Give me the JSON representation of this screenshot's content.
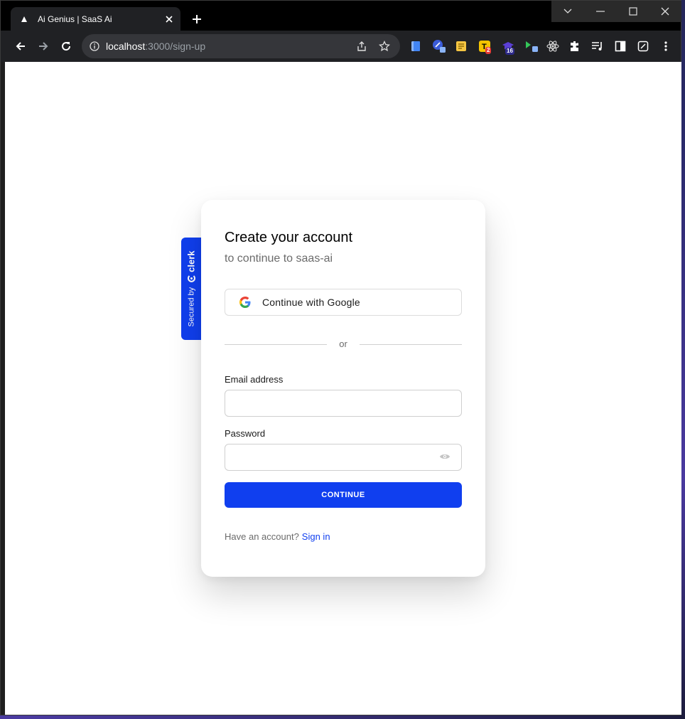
{
  "browser": {
    "tab_title": "Ai Genius | SaaS Ai",
    "url_host": "localhost",
    "url_path": ":3000/sign-up",
    "extensions": [
      {
        "name": "docs-ext-icon"
      },
      {
        "name": "translate-ext-icon"
      },
      {
        "name": "notes-ext-icon"
      },
      {
        "name": "tampermonkey-ext-icon",
        "badge": "2"
      },
      {
        "name": "grad-cap-ext-icon",
        "badge": "16"
      },
      {
        "name": "video-ext-icon"
      },
      {
        "name": "react-devtools-icon"
      },
      {
        "name": "puzzle-extensions-icon"
      },
      {
        "name": "media-controls-icon"
      },
      {
        "name": "side-panel-icon"
      },
      {
        "name": "notion-ext-icon"
      }
    ]
  },
  "secured_badge": {
    "prefix": "Secured by",
    "brand": "clerk"
  },
  "signup": {
    "title": "Create your account",
    "subtitle": "to continue to saas-ai",
    "google_button": "Continue with Google",
    "divider": "or",
    "email_label": "Email address",
    "email_value": "",
    "password_label": "Password",
    "password_value": "",
    "continue_button": "CONTINUE",
    "footer_prompt": "Have an account?",
    "footer_link": "Sign in"
  },
  "colors": {
    "accent": "#103fef",
    "page_bg": "#ffffff",
    "chrome_bg": "#202124"
  }
}
